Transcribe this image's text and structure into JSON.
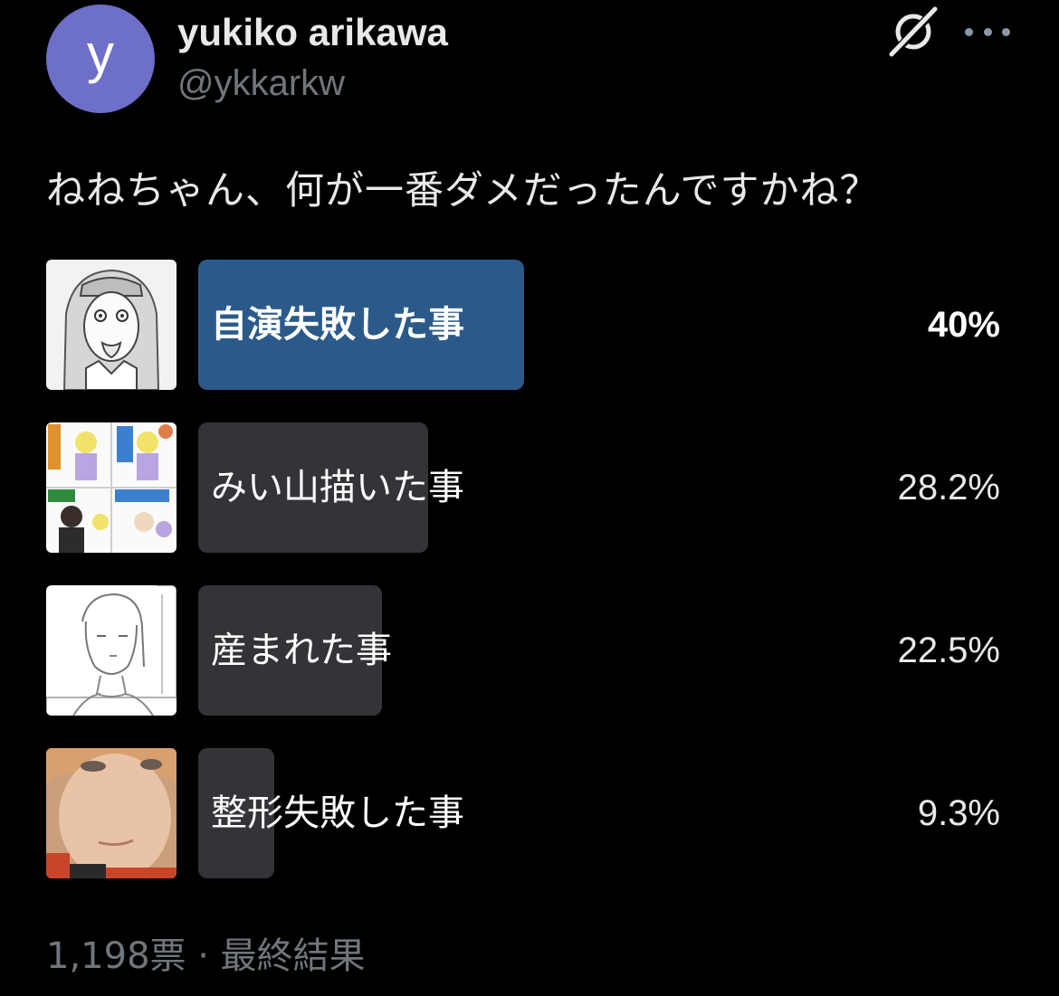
{
  "author": {
    "avatar_letter": "y",
    "avatar_color": "#6e6fc8",
    "display_name": "yukiko arikawa",
    "handle": "@ykkarkw"
  },
  "header_icons": [
    "grok-icon",
    "more-icon"
  ],
  "tweet_text": "ねねちゃん、何が一番ダメだったんですかね？",
  "poll": {
    "options": [
      {
        "label": "自演失敗した事",
        "percent_text": "40%",
        "percent": 40,
        "winner": true,
        "thumbnail": "manga-girl-sketch-image"
      },
      {
        "label": "みい山描いた事",
        "percent_text": "28.2%",
        "percent": 28.2,
        "winner": false,
        "thumbnail": "stamp-grid-image"
      },
      {
        "label": "産まれた事",
        "percent_text": "22.5%",
        "percent": 22.5,
        "winner": false,
        "thumbnail": "line-drawing-woman-image"
      },
      {
        "label": "整形失敗した事",
        "percent_text": "9.3%",
        "percent": 9.3,
        "winner": false,
        "thumbnail": "face-photo-image"
      }
    ],
    "footer": "1,198票 · 最終結果",
    "winner_color": "#2b5a8a",
    "bar_color": "#333438"
  }
}
